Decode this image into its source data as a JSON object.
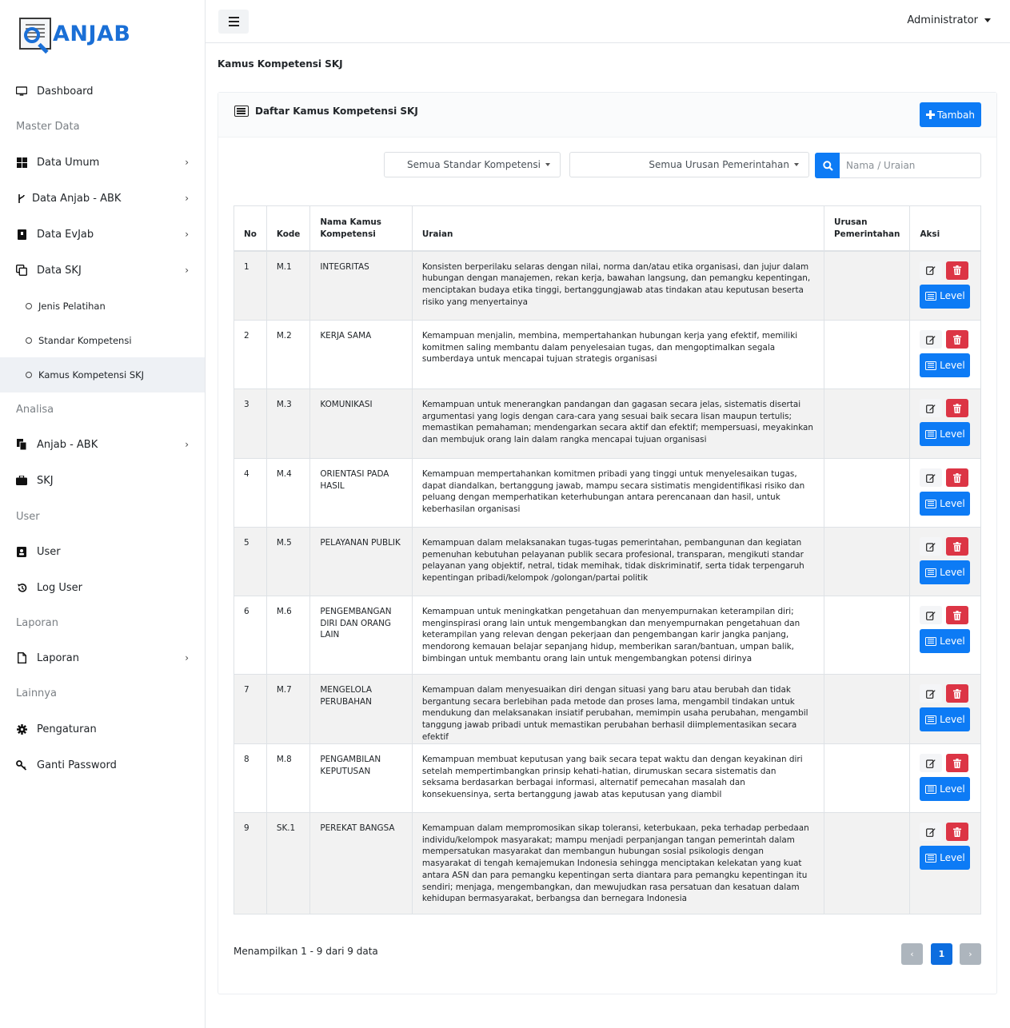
{
  "app": {
    "logo_text": "ANJAB"
  },
  "sidebar": {
    "dashboard": "Dashboard",
    "master_data_header": "Master Data",
    "data_umum": "Data Umum",
    "data_anjab_abk": "Data Anjab - ABK",
    "data_evjab": "Data EvJab",
    "data_skj": "Data SKJ",
    "jenis_pelatihan": "Jenis Pelatihan",
    "standar_kompetensi": "Standar Kompetensi",
    "kamus_kompetensi_skj": "Kamus Kompetensi SKJ",
    "analisa_header": "Analisa",
    "anjab_abk": "Anjab - ABK",
    "skj": "SKJ",
    "user_header": "User",
    "user": "User",
    "log_user": "Log User",
    "laporan_header": "Laporan",
    "laporan": "Laporan",
    "lainnya_header": "Lainnya",
    "pengaturan": "Pengaturan",
    "ganti_password": "Ganti Password"
  },
  "topbar": {
    "user_label": "Administrator"
  },
  "page": {
    "title": "Kamus Kompetensi SKJ"
  },
  "card": {
    "title": "Daftar Kamus Kompetensi SKJ",
    "add_button": "Tambah"
  },
  "filters": {
    "standar_kompetensi": "Semua Standar Kompetensi",
    "urusan_pemerintahan": "Semua Urusan Pemerintahan",
    "search_placeholder": "Nama / Uraian"
  },
  "table": {
    "headers": {
      "no": "No",
      "kode": "Kode",
      "nama": "Nama Kamus Kompetensi",
      "uraian": "Uraian",
      "urusan": "Urusan Pemerintahan",
      "aksi": "Aksi"
    },
    "level_label": "Level",
    "rows": [
      {
        "no": "1",
        "kode": "M.1",
        "nama": "INTEGRITAS",
        "uraian": "Konsisten berperilaku selaras dengan nilai, norma dan/atau etika organisasi, dan jujur dalam hubungan dengan manajemen, rekan kerja, bawahan langsung, dan pemangku kepentingan, menciptakan budaya etika tinggi, bertanggungjawab atas tindakan atau keputusan beserta risiko yang menyertainya",
        "urusan": ""
      },
      {
        "no": "2",
        "kode": "M.2",
        "nama": "KERJA SAMA",
        "uraian": "Kemampuan menjalin, membina, mempertahankan hubungan kerja yang efektif, memiliki komitmen saling membantu dalam penyelesaian tugas, dan mengoptimalkan segala sumberdaya untuk mencapai tujuan strategis organisasi",
        "urusan": ""
      },
      {
        "no": "3",
        "kode": "M.3",
        "nama": "KOMUNIKASI",
        "uraian": "Kemampuan untuk menerangkan pandangan dan gagasan secara jelas, sistematis disertai argumentasi yang logis dengan cara-cara yang sesuai baik secara lisan maupun tertulis; memastikan pemahaman; mendengarkan secara aktif dan efektif; mempersuasi, meyakinkan dan membujuk orang lain dalam rangka mencapai tujuan organisasi",
        "urusan": ""
      },
      {
        "no": "4",
        "kode": "M.4",
        "nama": "ORIENTASI PADA HASIL",
        "uraian": "Kemampuan mempertahankan komitmen pribadi yang tinggi untuk menyelesaikan tugas, dapat diandalkan, bertanggung jawab, mampu secara sistimatis mengidentifikasi risiko dan peluang dengan memperhatikan keterhubungan antara perencanaan dan hasil, untuk keberhasilan organisasi",
        "urusan": ""
      },
      {
        "no": "5",
        "kode": "M.5",
        "nama": "PELAYANAN PUBLIK",
        "uraian": "Kemampuan dalam melaksanakan tugas-tugas pemerintahan, pembangunan dan kegiatan pemenuhan kebutuhan pelayanan publik secara profesional, transparan, mengikuti standar pelayanan yang objektif, netral, tidak memihak, tidak diskriminatif, serta tidak terpengaruh kepentingan pribadi/kelompok /golongan/partai politik",
        "urusan": ""
      },
      {
        "no": "6",
        "kode": "M.6",
        "nama": "PENGEMBANGAN DIRI DAN ORANG LAIN",
        "uraian": "Kemampuan untuk meningkatkan pengetahuan dan menyempurnakan keterampilan diri; menginspirasi orang lain untuk mengembangkan dan menyempurnakan pengetahuan dan keterampilan yang relevan dengan pekerjaan dan pengembangan karir jangka panjang, mendorong kemauan belajar sepanjang hidup, memberikan saran/bantuan, umpan balik, bimbingan untuk membantu orang lain untuk mengembangkan potensi dirinya",
        "urusan": ""
      },
      {
        "no": "7",
        "kode": "M.7",
        "nama": "MENGELOLA PERUBAHAN",
        "uraian": "Kemampuan dalam menyesuaikan diri dengan situasi yang baru atau berubah dan tidak bergantung secara berlebihan pada metode dan proses lama, mengambil tindakan untuk mendukung dan melaksanakan insiatif perubahan, memimpin usaha perubahan, mengambil tanggung jawab pribadi untuk memastikan perubahan berhasil diimplementasikan secara efektif",
        "urusan": ""
      },
      {
        "no": "8",
        "kode": "M.8",
        "nama": "PENGAMBILAN KEPUTUSAN",
        "uraian": "Kemampuan membuat keputusan yang baik secara tepat waktu dan dengan keyakinan diri setelah mempertimbangkan prinsip kehati-hatian, dirumuskan secara sistematis dan seksama berdasarkan berbagai informasi, alternatif pemecahan masalah dan konsekuensinya, serta bertanggung jawab atas keputusan yang diambil",
        "urusan": ""
      },
      {
        "no": "9",
        "kode": "SK.1",
        "nama": "PEREKAT BANGSA",
        "uraian": "Kemampuan dalam mempromosikan sikap toleransi, keterbukaan, peka terhadap perbedaan individu/kelompok masyarakat; mampu menjadi perpanjangan tangan pemerintah dalam mempersatukan masyarakat dan membangun hubungan sosial psikologis dengan masyarakat di tengah kemajemukan Indonesia sehingga menciptakan kelekatan yang kuat antara ASN dan para pemangku kepentingan serta diantara para pemangku kepentingan itu sendiri; menjaga, mengembangkan, dan mewujudkan rasa persatuan dan kesatuan dalam kehidupan bermasyarakat, berbangsa dan bernegara Indonesia",
        "urusan": ""
      }
    ]
  },
  "footer": {
    "info": "Menampilkan 1 - 9 dari 9 data",
    "page_prev": "‹",
    "page_current": "1",
    "page_next": "›"
  },
  "colors": {
    "primary": "#0d7bf5",
    "danger": "#dc3545"
  }
}
